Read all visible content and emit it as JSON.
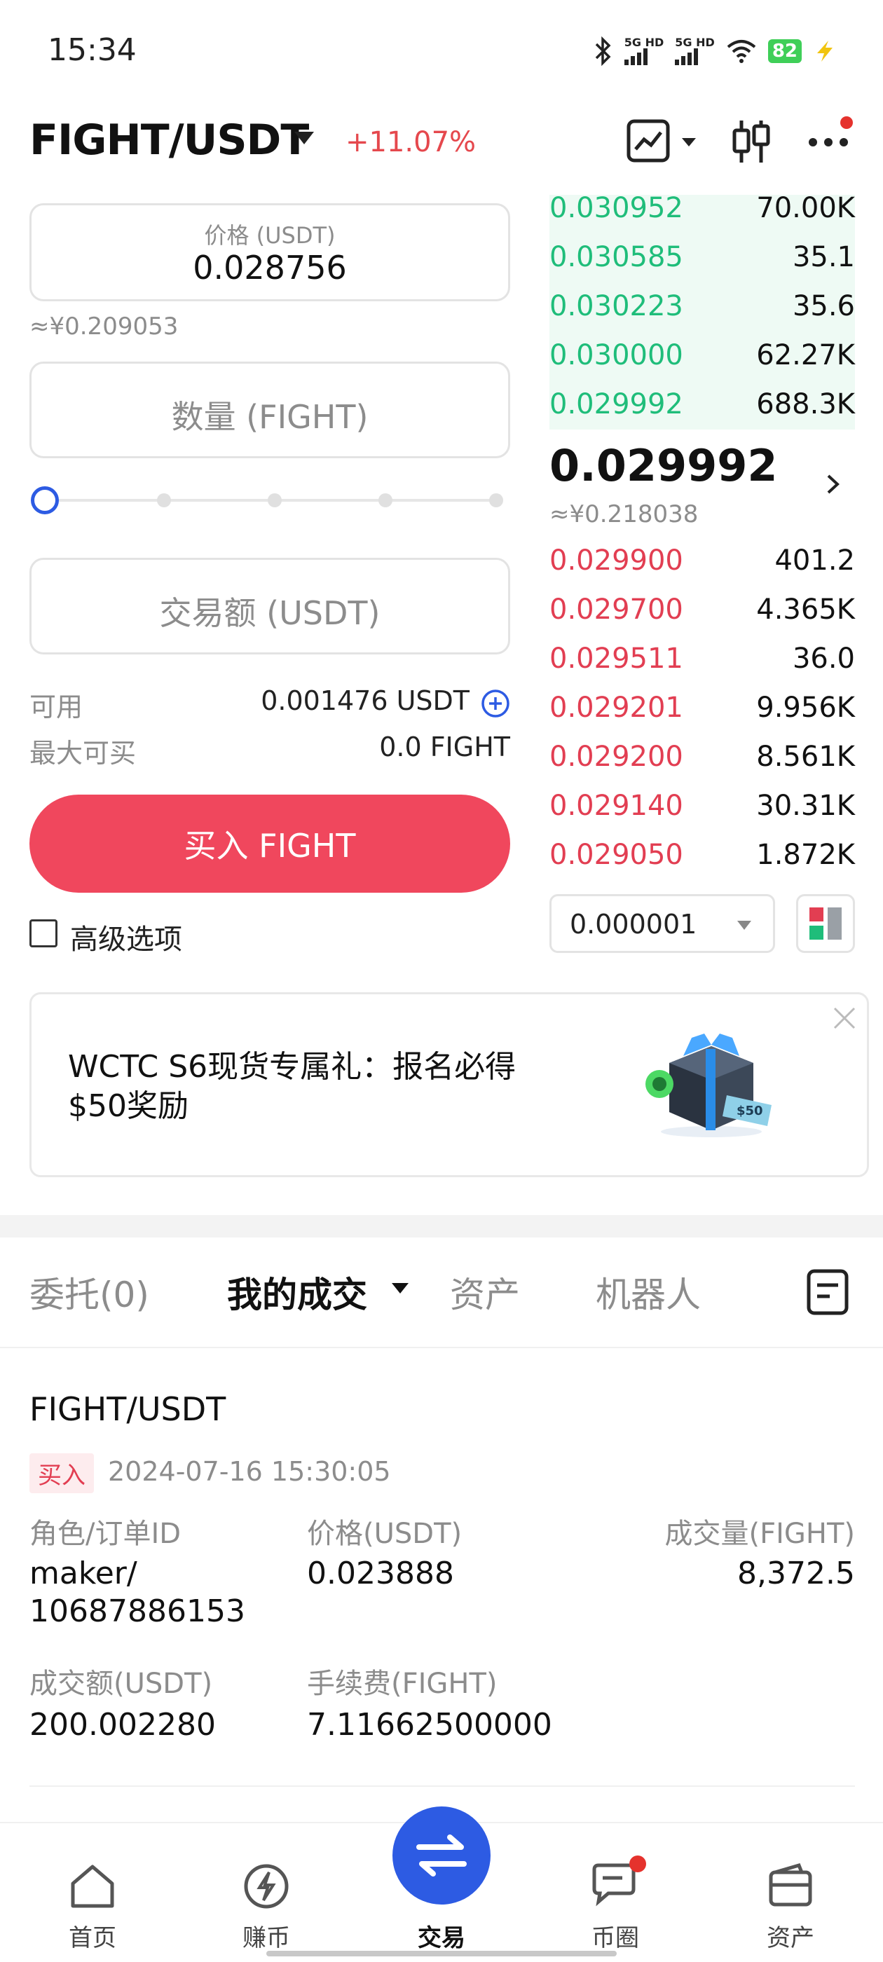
{
  "status_bar": {
    "time": "15:34",
    "sim1": "5G HD",
    "sim2": "5G HD",
    "battery": "82",
    "icons": [
      "bluetooth-icon",
      "signal-icon",
      "wifi-icon",
      "battery-icon",
      "charging-icon"
    ]
  },
  "header": {
    "pair": "FIGHT/USDT",
    "change": "+11.07%",
    "icons": [
      "chart-line-icon",
      "candlestick-icon",
      "more-icon"
    ]
  },
  "form": {
    "price_label": "价格 (USDT)",
    "price_value": "0.028756",
    "price_cny": "≈¥0.209053",
    "qty_placeholder": "数量 (FIGHT)",
    "total_placeholder": "交易额 (USDT)",
    "slider_percent": 0,
    "available_label": "可用",
    "available_value": "0.001476 USDT",
    "max_buy_label": "最大可买",
    "max_buy_value": "0.0 FIGHT",
    "buy_button": "买入 FIGHT",
    "advanced_label": "高级选项"
  },
  "orderbook": {
    "asks": [
      {
        "price": "0.030952",
        "qty": "70.00K"
      },
      {
        "price": "0.030585",
        "qty": "35.1"
      },
      {
        "price": "0.030223",
        "qty": "35.6"
      },
      {
        "price": "0.030000",
        "qty": "62.27K"
      },
      {
        "price": "0.029992",
        "qty": "688.3K"
      }
    ],
    "last_price": "0.029992",
    "last_price_cny": "≈¥0.218038",
    "bids": [
      {
        "price": "0.029900",
        "qty": "401.2"
      },
      {
        "price": "0.029700",
        "qty": "4.365K"
      },
      {
        "price": "0.029511",
        "qty": "36.0"
      },
      {
        "price": "0.029201",
        "qty": "9.956K"
      },
      {
        "price": "0.029200",
        "qty": "8.561K"
      },
      {
        "price": "0.029140",
        "qty": "30.31K"
      },
      {
        "price": "0.029050",
        "qty": "1.872K"
      }
    ],
    "precision": "0.000001"
  },
  "banner": {
    "line1": "WCTC S6现货专属礼：报名必得",
    "line2": "$50奖励",
    "badge": "$50"
  },
  "tabs": {
    "orders": "委托(0)",
    "my_trades": "我的成交",
    "assets": "资产",
    "robot": "机器人"
  },
  "trade": {
    "pair": "FIGHT/USDT",
    "side": "买入",
    "time": "2024-07-16 15:30:05",
    "role_label": "角色/订单ID",
    "role_value_1": "maker/",
    "role_value_2": "10687886153",
    "price_label": "价格(USDT)",
    "price_value": "0.023888",
    "volume_label": "成交量(FIGHT)",
    "volume_value": "8,372.5",
    "amount_label": "成交额(USDT)",
    "amount_value": "200.002280",
    "fee_label": "手续费(FIGHT)",
    "fee_value": "7.11662500000"
  },
  "nav": {
    "home": "首页",
    "earn": "赚币",
    "trade": "交易",
    "social": "币圈",
    "assets": "资产"
  },
  "colors": {
    "accent_blue": "#2d5be3",
    "buy_red": "#f0475d",
    "ask_green": "#1fbd7a",
    "bid_red": "#e23e52"
  }
}
